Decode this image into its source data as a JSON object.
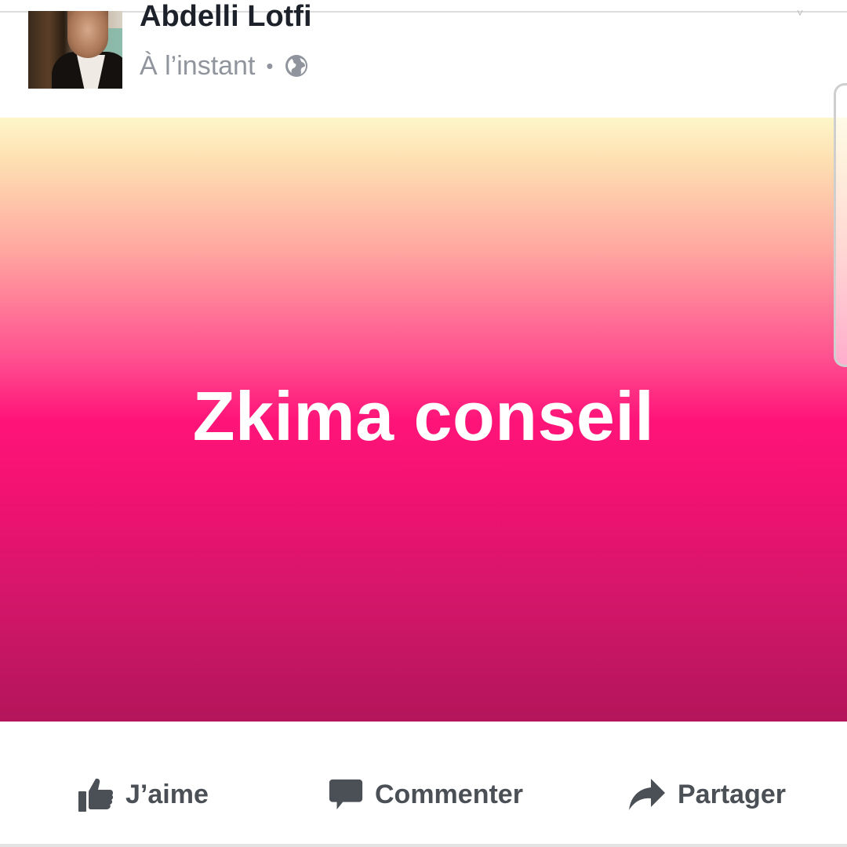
{
  "post": {
    "author_name": "Abdelli Lotfi",
    "timestamp": "À l’instant",
    "separator": "•",
    "privacy_icon": "globe-icon",
    "banner_text": "Zkima conseil",
    "banner_colors": [
      "#fdf6c9",
      "#ff1479",
      "#b3155b"
    ]
  },
  "actions": {
    "like_label": "J’aime",
    "like_icon": "thumbs-up-icon",
    "comment_label": "Commenter",
    "comment_icon": "comment-bubble-icon",
    "share_label": "Partager",
    "share_icon": "share-arrow-icon",
    "icon_color": "#4b4f56"
  }
}
